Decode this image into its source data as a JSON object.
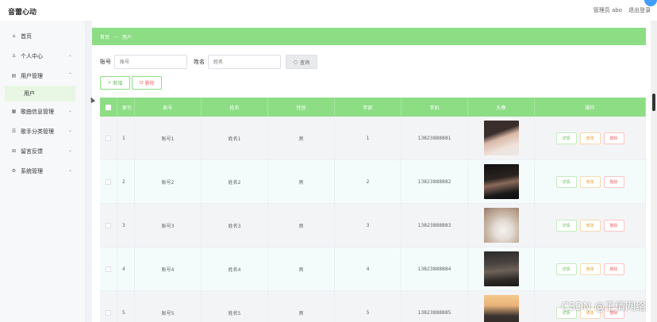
{
  "app": {
    "title": "音蕾心动"
  },
  "topbar": {
    "role": "管理员 abo",
    "logout": "退出登录"
  },
  "sidebar": {
    "items": [
      {
        "label": "首页",
        "icon": "home-icon",
        "expandable": false
      },
      {
        "label": "个人中心",
        "icon": "user-icon",
        "expandable": true
      },
      {
        "label": "用户管理",
        "icon": "users-icon",
        "expandable": true
      },
      {
        "label": "歌曲信息管理",
        "icon": "music-icon",
        "expandable": true
      },
      {
        "label": "歌手分类管理",
        "icon": "list-icon",
        "expandable": true
      },
      {
        "label": "留言反馈",
        "icon": "grid-icon",
        "expandable": true
      },
      {
        "label": "系统管理",
        "icon": "gear-icon",
        "expandable": true
      }
    ],
    "active_sub": "用户"
  },
  "breadcrumb": {
    "home": "首页",
    "sep": "—",
    "current": "用户"
  },
  "search": {
    "account_label": "账号",
    "account_placeholder": "账号",
    "name_label": "姓名",
    "name_placeholder": "姓名",
    "button": "查询"
  },
  "actions": {
    "add": "新增",
    "delete": "删除"
  },
  "table": {
    "headers": [
      "索引",
      "账号",
      "姓名",
      "性别",
      "年龄",
      "手机",
      "头像",
      "操作"
    ],
    "rows": [
      {
        "index": "1",
        "account": "账号1",
        "name": "姓名1",
        "gender": "男",
        "age": "1",
        "phone": "13823888881"
      },
      {
        "index": "2",
        "account": "账号2",
        "name": "姓名2",
        "gender": "男",
        "age": "2",
        "phone": "13823888882"
      },
      {
        "index": "3",
        "account": "账号3",
        "name": "姓名3",
        "gender": "男",
        "age": "3",
        "phone": "13823888883"
      },
      {
        "index": "4",
        "account": "账号4",
        "name": "姓名4",
        "gender": "男",
        "age": "4",
        "phone": "13823888884"
      },
      {
        "index": "5",
        "account": "账号5",
        "name": "姓名5",
        "gender": "男",
        "age": "5",
        "phone": "13823888885"
      }
    ],
    "ops": {
      "detail": "详情",
      "edit": "修改",
      "remove": "删除"
    }
  },
  "watermark": "CSDN @王倩网络",
  "colors": {
    "accent": "#8ddd85",
    "danger": "#f56c6c",
    "warning": "#e6a23c"
  }
}
